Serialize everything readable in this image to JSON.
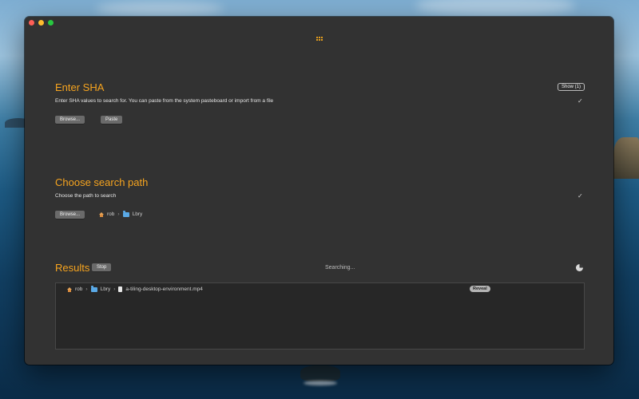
{
  "window": {
    "sha_section": {
      "title": "Enter SHA",
      "description": "Enter SHA values to search for. You can paste from the system pasteboard or import from a file",
      "browse_label": "Browse...",
      "paste_label": "Paste",
      "show_label": "Show (1)",
      "check": "✓"
    },
    "path_section": {
      "title": "Choose search path",
      "description": "Choose the path to search",
      "browse_label": "Browse...",
      "path": [
        "rob",
        "Lbry"
      ],
      "check": "✓"
    },
    "results_section": {
      "title": "Results",
      "stop_label": "Stop",
      "status": "Searching...",
      "rows": [
        {
          "path": [
            "rob",
            "Lbry",
            "a-tiling-desktop-environment.mp4"
          ],
          "action": "Reveal"
        }
      ]
    }
  },
  "colors": {
    "accent": "#f6a41f",
    "window_bg": "#323232",
    "results_bg": "#272727"
  }
}
